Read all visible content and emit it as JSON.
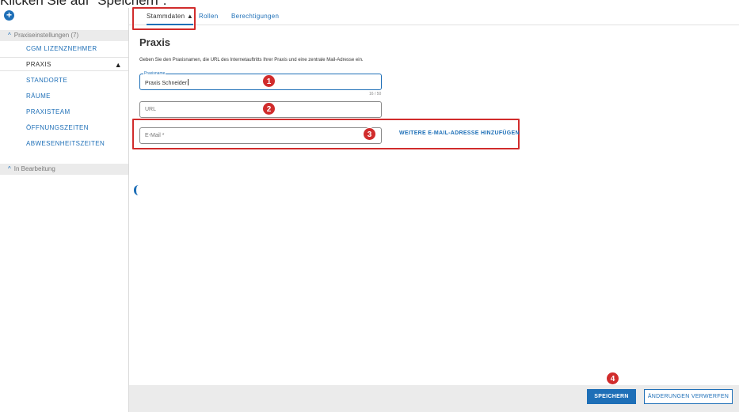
{
  "caption": "Klicken Sie auf \"Speichern\".",
  "sidebar": {
    "add_symbol": "+",
    "group1": {
      "caret": "^",
      "label": "Praxiseinstellungen (7)"
    },
    "items": [
      {
        "label": "CGM LIZENZNEHMER"
      },
      {
        "label": "PRAXIS",
        "active": true
      },
      {
        "label": "STANDORTE"
      },
      {
        "label": "RÄUME"
      },
      {
        "label": "PRAXISTEAM"
      },
      {
        "label": "ÖFFNUNGSZEITEN"
      },
      {
        "label": "ABWESENHEITSZEITEN"
      }
    ],
    "active_marker": "▲",
    "group2": {
      "caret": "^",
      "label": "In Bearbeitung"
    }
  },
  "tabs": [
    {
      "label": "Stammdaten",
      "marker": "▲",
      "active": true
    },
    {
      "label": "Rollen"
    },
    {
      "label": "Berechtigungen"
    }
  ],
  "main": {
    "title": "Praxis",
    "description": "Geben Sie den Praxisnamen, die URL des Internetauftritts Ihrer Praxis und eine zentrale Mail-Adresse ein.",
    "praxisname": {
      "label": "Praxisname",
      "value": "Praxis Schneider",
      "counter": "16 / 50"
    },
    "url": {
      "placeholder": "URL"
    },
    "email": {
      "placeholder": "E-Mail *"
    },
    "add_email_link": "WEITERE E-MAIL-ADRESSE HINZUFÜGEN"
  },
  "badges": [
    "1",
    "2",
    "3",
    "4"
  ],
  "footer": {
    "save_label": "SPEICHERN",
    "discard_label": "ÄNDERUNGEN VERWERFEN"
  },
  "colors": {
    "accent": "#1e6fb7",
    "highlight": "#d12c2c",
    "sidebar_group_bg": "#ebebeb"
  }
}
